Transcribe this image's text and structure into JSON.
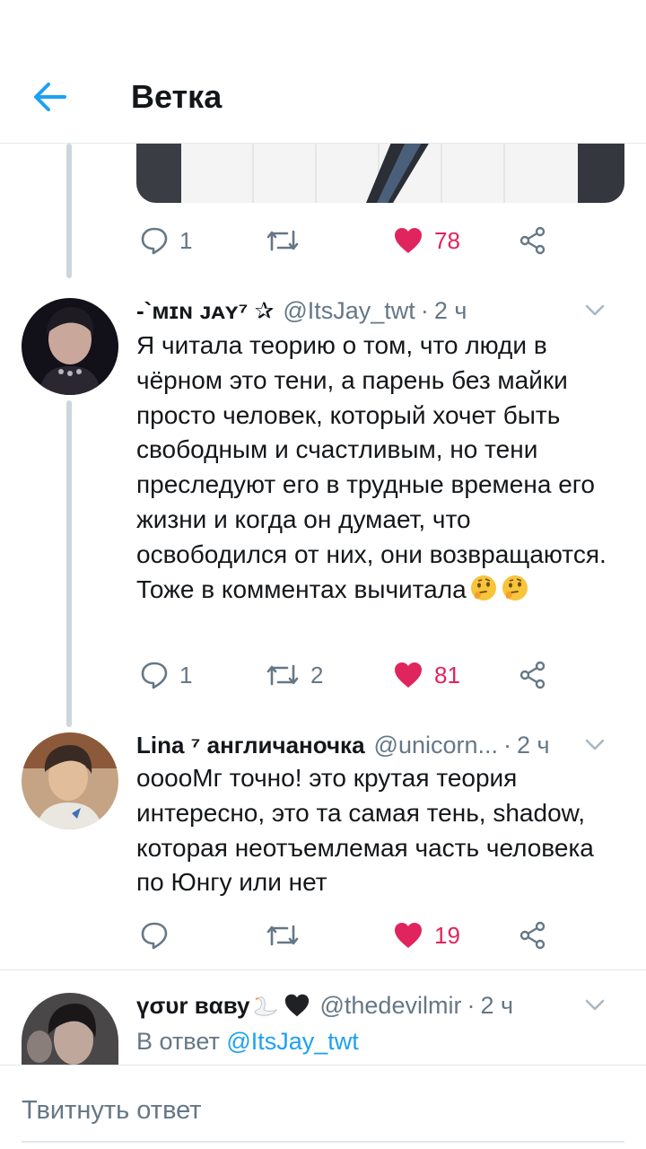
{
  "header": {
    "title": "Ветка"
  },
  "colors": {
    "accent": "#1da1f2",
    "like": "#e0245e",
    "muted": "#657786",
    "text": "#14171a",
    "border": "#e1e8ed"
  },
  "first_tweet_actions": {
    "replies": "1",
    "retweets": "",
    "likes": "78"
  },
  "tweets": [
    {
      "name": "-`ᴍɪɴ ᴊᴀʏ⁷ ✰",
      "handle": "@ItsJay_twt",
      "separator": "·",
      "time": "2 ч",
      "text": "Я читала теорию о том, что люди в чёрном это тени, а парень без майки просто человек, который хочет быть свободным и счастливым, но тени преследуют его в трудные времена его жизни и когда он думает, что освободился от них, они возвращаются.",
      "text2": "Тоже в комментах вычитала",
      "emojis": [
        "thinking-face",
        "thinking-face"
      ],
      "replies": "1",
      "retweets": "2",
      "likes": "81"
    },
    {
      "name": "Lina ⁷ англичаночка",
      "handle": "@unicorn...",
      "separator": "·",
      "time": "2 ч",
      "text": "ооооМг точно! это крутая теория интересно, это та самая тень, shadow, которая неотъемлемая часть человека по Юнгу или нет",
      "replies": "",
      "retweets": "",
      "likes": "19"
    },
    {
      "name": "үσυr вαву",
      "handle": "@thedevilmir",
      "separator": "·",
      "time": "2 ч",
      "name_emojis": [
        "swan",
        "black-heart"
      ],
      "reply_prefix": "В ответ",
      "reply_mention": "@ItsJay_twt"
    }
  ],
  "compose": {
    "placeholder": "Твитнуть ответ"
  }
}
